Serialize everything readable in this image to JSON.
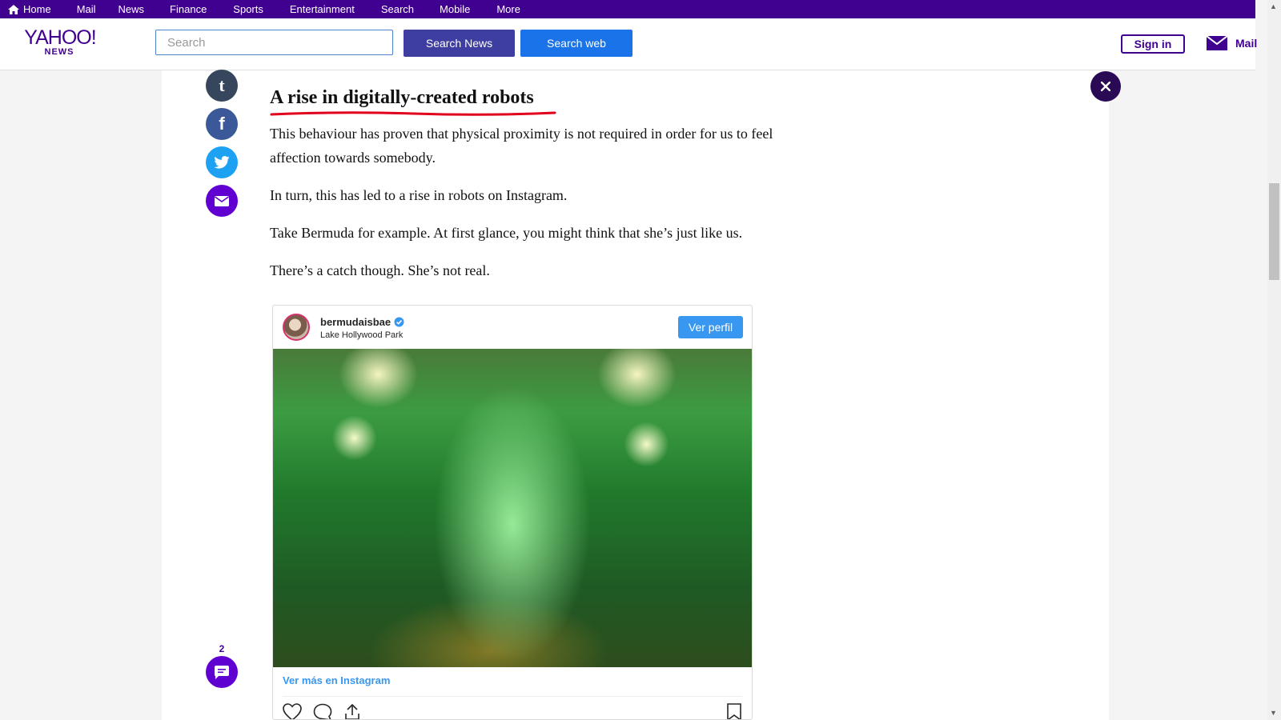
{
  "topnav": {
    "items": [
      "Home",
      "Mail",
      "News",
      "Finance",
      "Sports",
      "Entertainment",
      "Search",
      "Mobile",
      "More"
    ]
  },
  "header": {
    "logo_main": "YAHOO!",
    "logo_sub": "NEWS",
    "search_placeholder": "Search",
    "search_news_label": "Search News",
    "search_web_label": "Search web",
    "signin_label": "Sign in",
    "mail_label": "Mail"
  },
  "share": {
    "tumblr_glyph": "t",
    "facebook_glyph": "f"
  },
  "article": {
    "headline": "A rise in digitally-created robots",
    "paragraphs": [
      "This behaviour has proven that physical proximity is not required in order for us to feel affection towards somebody.",
      "In turn, this has led to a rise in robots on Instagram.",
      "Take Bermuda for example. At first glance, you might think that she’s just like us.",
      "There’s a catch though. She’s not real."
    ]
  },
  "instagram": {
    "username": "bermudaisbae",
    "location": "Lake Hollywood Park",
    "profile_button": "Ver perfil",
    "more_link": "Ver más en Instagram"
  },
  "comments": {
    "count": "2"
  },
  "colors": {
    "brand_purple": "#400090",
    "accent_blue": "#1a73e8",
    "headline_underline": "#e0001b",
    "instagram_blue": "#3897f0"
  }
}
